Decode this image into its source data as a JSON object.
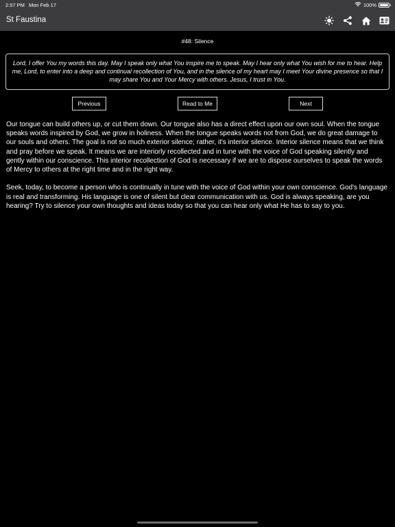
{
  "status_bar": {
    "time": "2:57 PM",
    "date": "Mon Feb 17",
    "battery": "100%",
    "battery_level": 1.0
  },
  "nav": {
    "title": "St Faustina",
    "icons": [
      "brightness-icon",
      "share-icon",
      "home-icon",
      "contact-card-icon"
    ]
  },
  "page": {
    "title": "#48: Silence",
    "prayer": "Lord, I offer You my words this day.  May I speak only what You inspire me to speak.  May I hear only what You wish for me to hear.  Help me, Lord, to enter into a deep and continual recollection of You, and in the silence of my heart may I meet Your divine presence so that I may share You and Your Mercy with others.  Jesus, I trust in You.",
    "buttons": {
      "previous": "Previous",
      "read": "Read to Me",
      "next": "Next"
    },
    "paragraphs": [
      "Our tongue can build others up, or cut them down.  Our tongue also has a direct effect upon our own soul.  When the tongue speaks words inspired by God, we grow in holiness.  When the tongue speaks words not from God, we do great damage to our souls and others.  The goal is not so much exterior silence; rather, it's interior silence.  Interior silence means that we think and pray before we speak.  It means we are interiorly recollected and in tune with the voice of God speaking silently and gently within our conscience.  This interior recollection of God is necessary if we are to dispose ourselves to speak the words of Mercy to others at the right time and in the right way.",
      "Seek, today, to become a person who is continually in tune with the voice of God within your own conscience.  God's language is real and transforming.  His language is one of silent but clear communication with us.  God is always speaking, are you hearing?  Try to silence your own thoughts and ideas today so that you can hear only what He has to say to you."
    ]
  },
  "colors": {
    "background": "#000000",
    "bar": "#3c3c3e",
    "text": "#ffffff",
    "border": "#cfcfcf"
  }
}
